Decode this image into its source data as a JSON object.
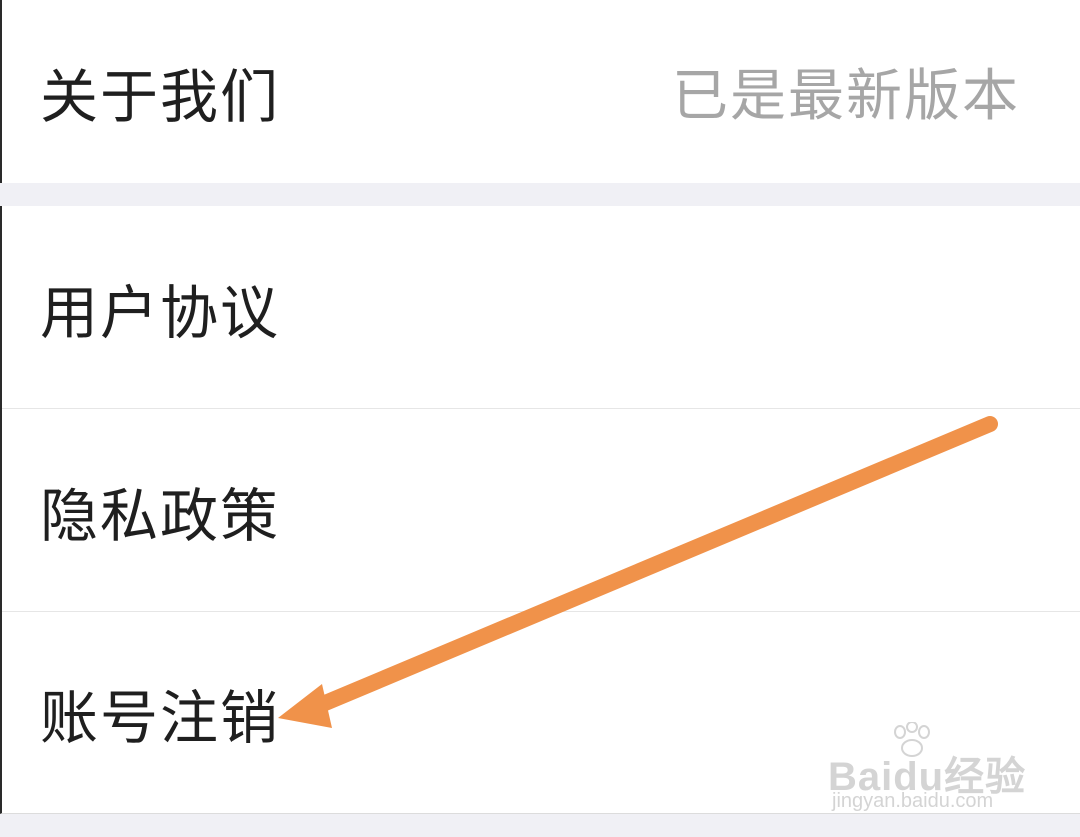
{
  "settings": {
    "about": {
      "label": "关于我们",
      "status": "已是最新版本"
    },
    "items": [
      {
        "label": "用户协议"
      },
      {
        "label": "隐私政策"
      },
      {
        "label": "账号注销"
      }
    ]
  },
  "annotation": {
    "arrow_color": "#f0924a",
    "points_to": "账号注销"
  },
  "watermark": {
    "brand_latin": "Bai",
    "brand_du": "du",
    "brand_cn": "经验",
    "url": "jingyan.baidu.com"
  },
  "colors": {
    "background": "#f0f0f5",
    "card": "#ffffff",
    "text": "#1f1f1f",
    "status_text": "#a6a6a6"
  }
}
